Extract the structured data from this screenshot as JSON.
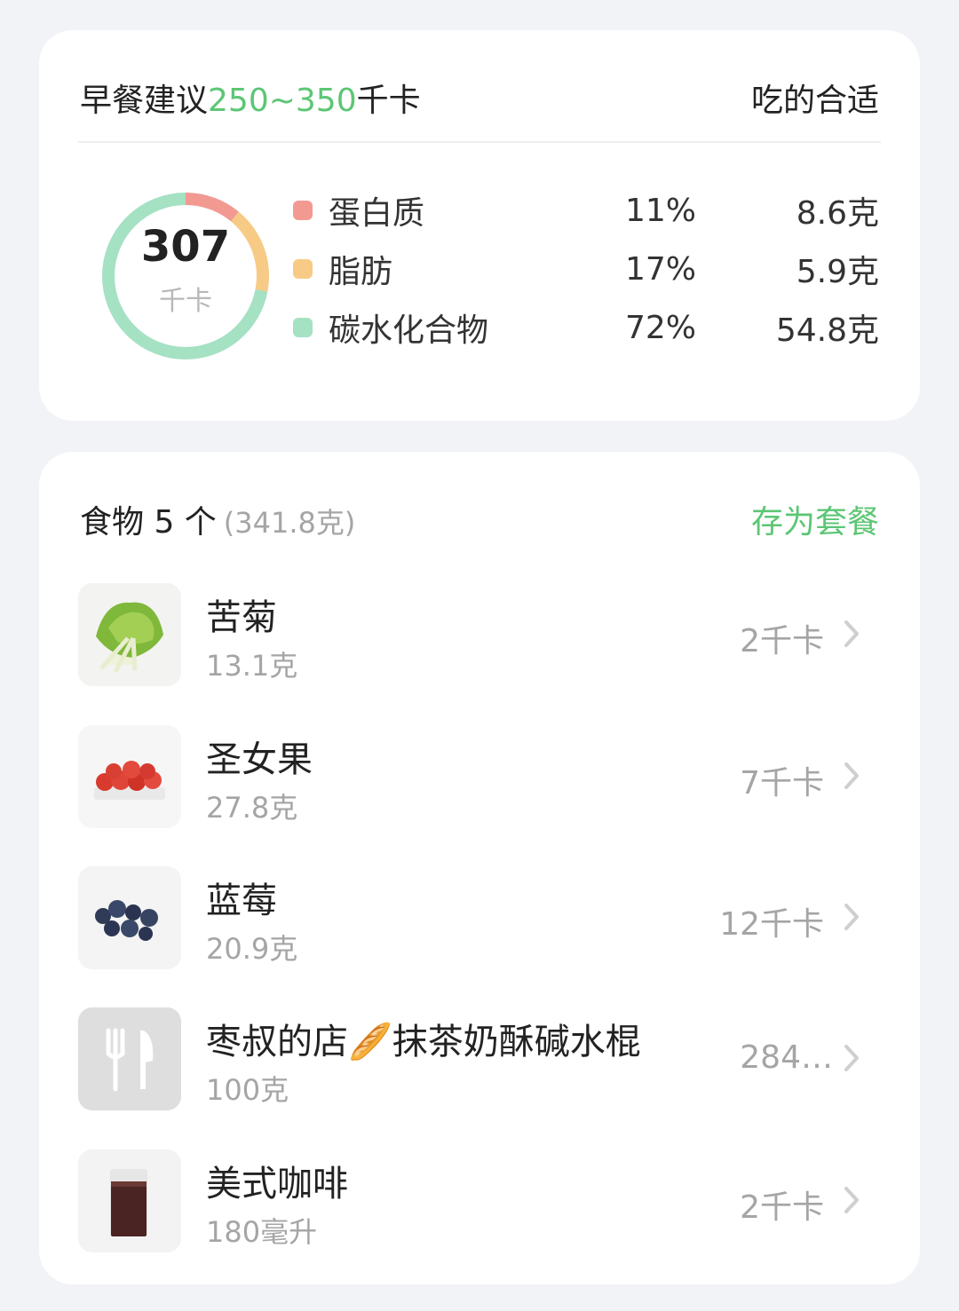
{
  "summary": {
    "title_prefix": "早餐建议",
    "range": "250~350",
    "unit": "千卡",
    "verdict": "吃的合适",
    "total_kcal": "307",
    "total_unit": "千卡",
    "ring_colors": {
      "protein": "#f29a92",
      "fat": "#f7cb86",
      "carbs": "#a5e1c3"
    },
    "macros": [
      {
        "name": "蛋白质",
        "pct": "11%",
        "grams": "8.6克",
        "fraction": 0.11,
        "color": "#f29a92"
      },
      {
        "name": "脂肪",
        "pct": "17%",
        "grams": "5.9克",
        "fraction": 0.17,
        "color": "#f7cb86"
      },
      {
        "name": "碳水化合物",
        "pct": "72%",
        "grams": "54.8克",
        "fraction": 0.72,
        "color": "#a5e1c3"
      }
    ]
  },
  "foods_section": {
    "title": "食物 5 个",
    "total_weight": "(341.8克)",
    "save_label": "存为套餐",
    "accent_color": "#5cc674",
    "items": [
      {
        "name": "苦菊",
        "qty": "13.1克",
        "kcal": "2千卡",
        "icon": "endive-photo"
      },
      {
        "name": "圣女果",
        "qty": "27.8克",
        "kcal": "7千卡",
        "icon": "cherry-tomato-photo"
      },
      {
        "name": "蓝莓",
        "qty": "20.9克",
        "kcal": "12千卡",
        "icon": "blueberry-photo"
      },
      {
        "name": "枣叔的店🥖抹茶奶酥碱水棍",
        "qty": "100克",
        "kcal": "284…",
        "icon": "fork-knife-icon"
      },
      {
        "name": "美式咖啡",
        "qty": "180毫升",
        "kcal": "2千卡",
        "icon": "coffee-cup-photo"
      }
    ]
  }
}
